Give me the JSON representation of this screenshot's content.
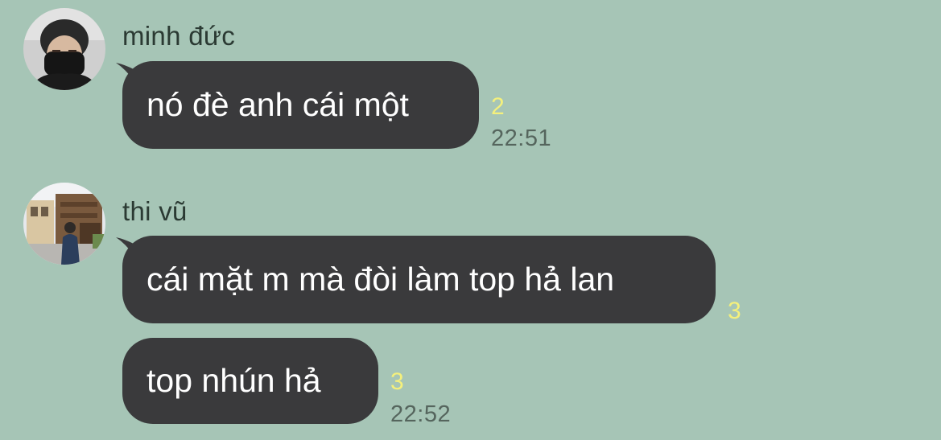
{
  "colors": {
    "background": "#a6c5b6",
    "bubble": "#3a3a3c",
    "bubble_text": "#ffffff",
    "read_count": "#f4f07c",
    "timestamp": "#55655d",
    "sender_name": "#2b3a33"
  },
  "messages": [
    {
      "sender": "minh đức",
      "avatar": "avatar-person-masked-icon",
      "bubbles": [
        {
          "text": "nó đè anh cái một",
          "read_count": "2",
          "time": "22:51"
        }
      ]
    },
    {
      "sender": "thi vũ",
      "avatar": "avatar-person-street-icon",
      "bubbles": [
        {
          "text": "cái mặt m mà đòi làm top hả lan",
          "read_count": "3",
          "time": ""
        },
        {
          "text": "top nhún hả",
          "read_count": "3",
          "time": "22:52"
        }
      ]
    }
  ]
}
